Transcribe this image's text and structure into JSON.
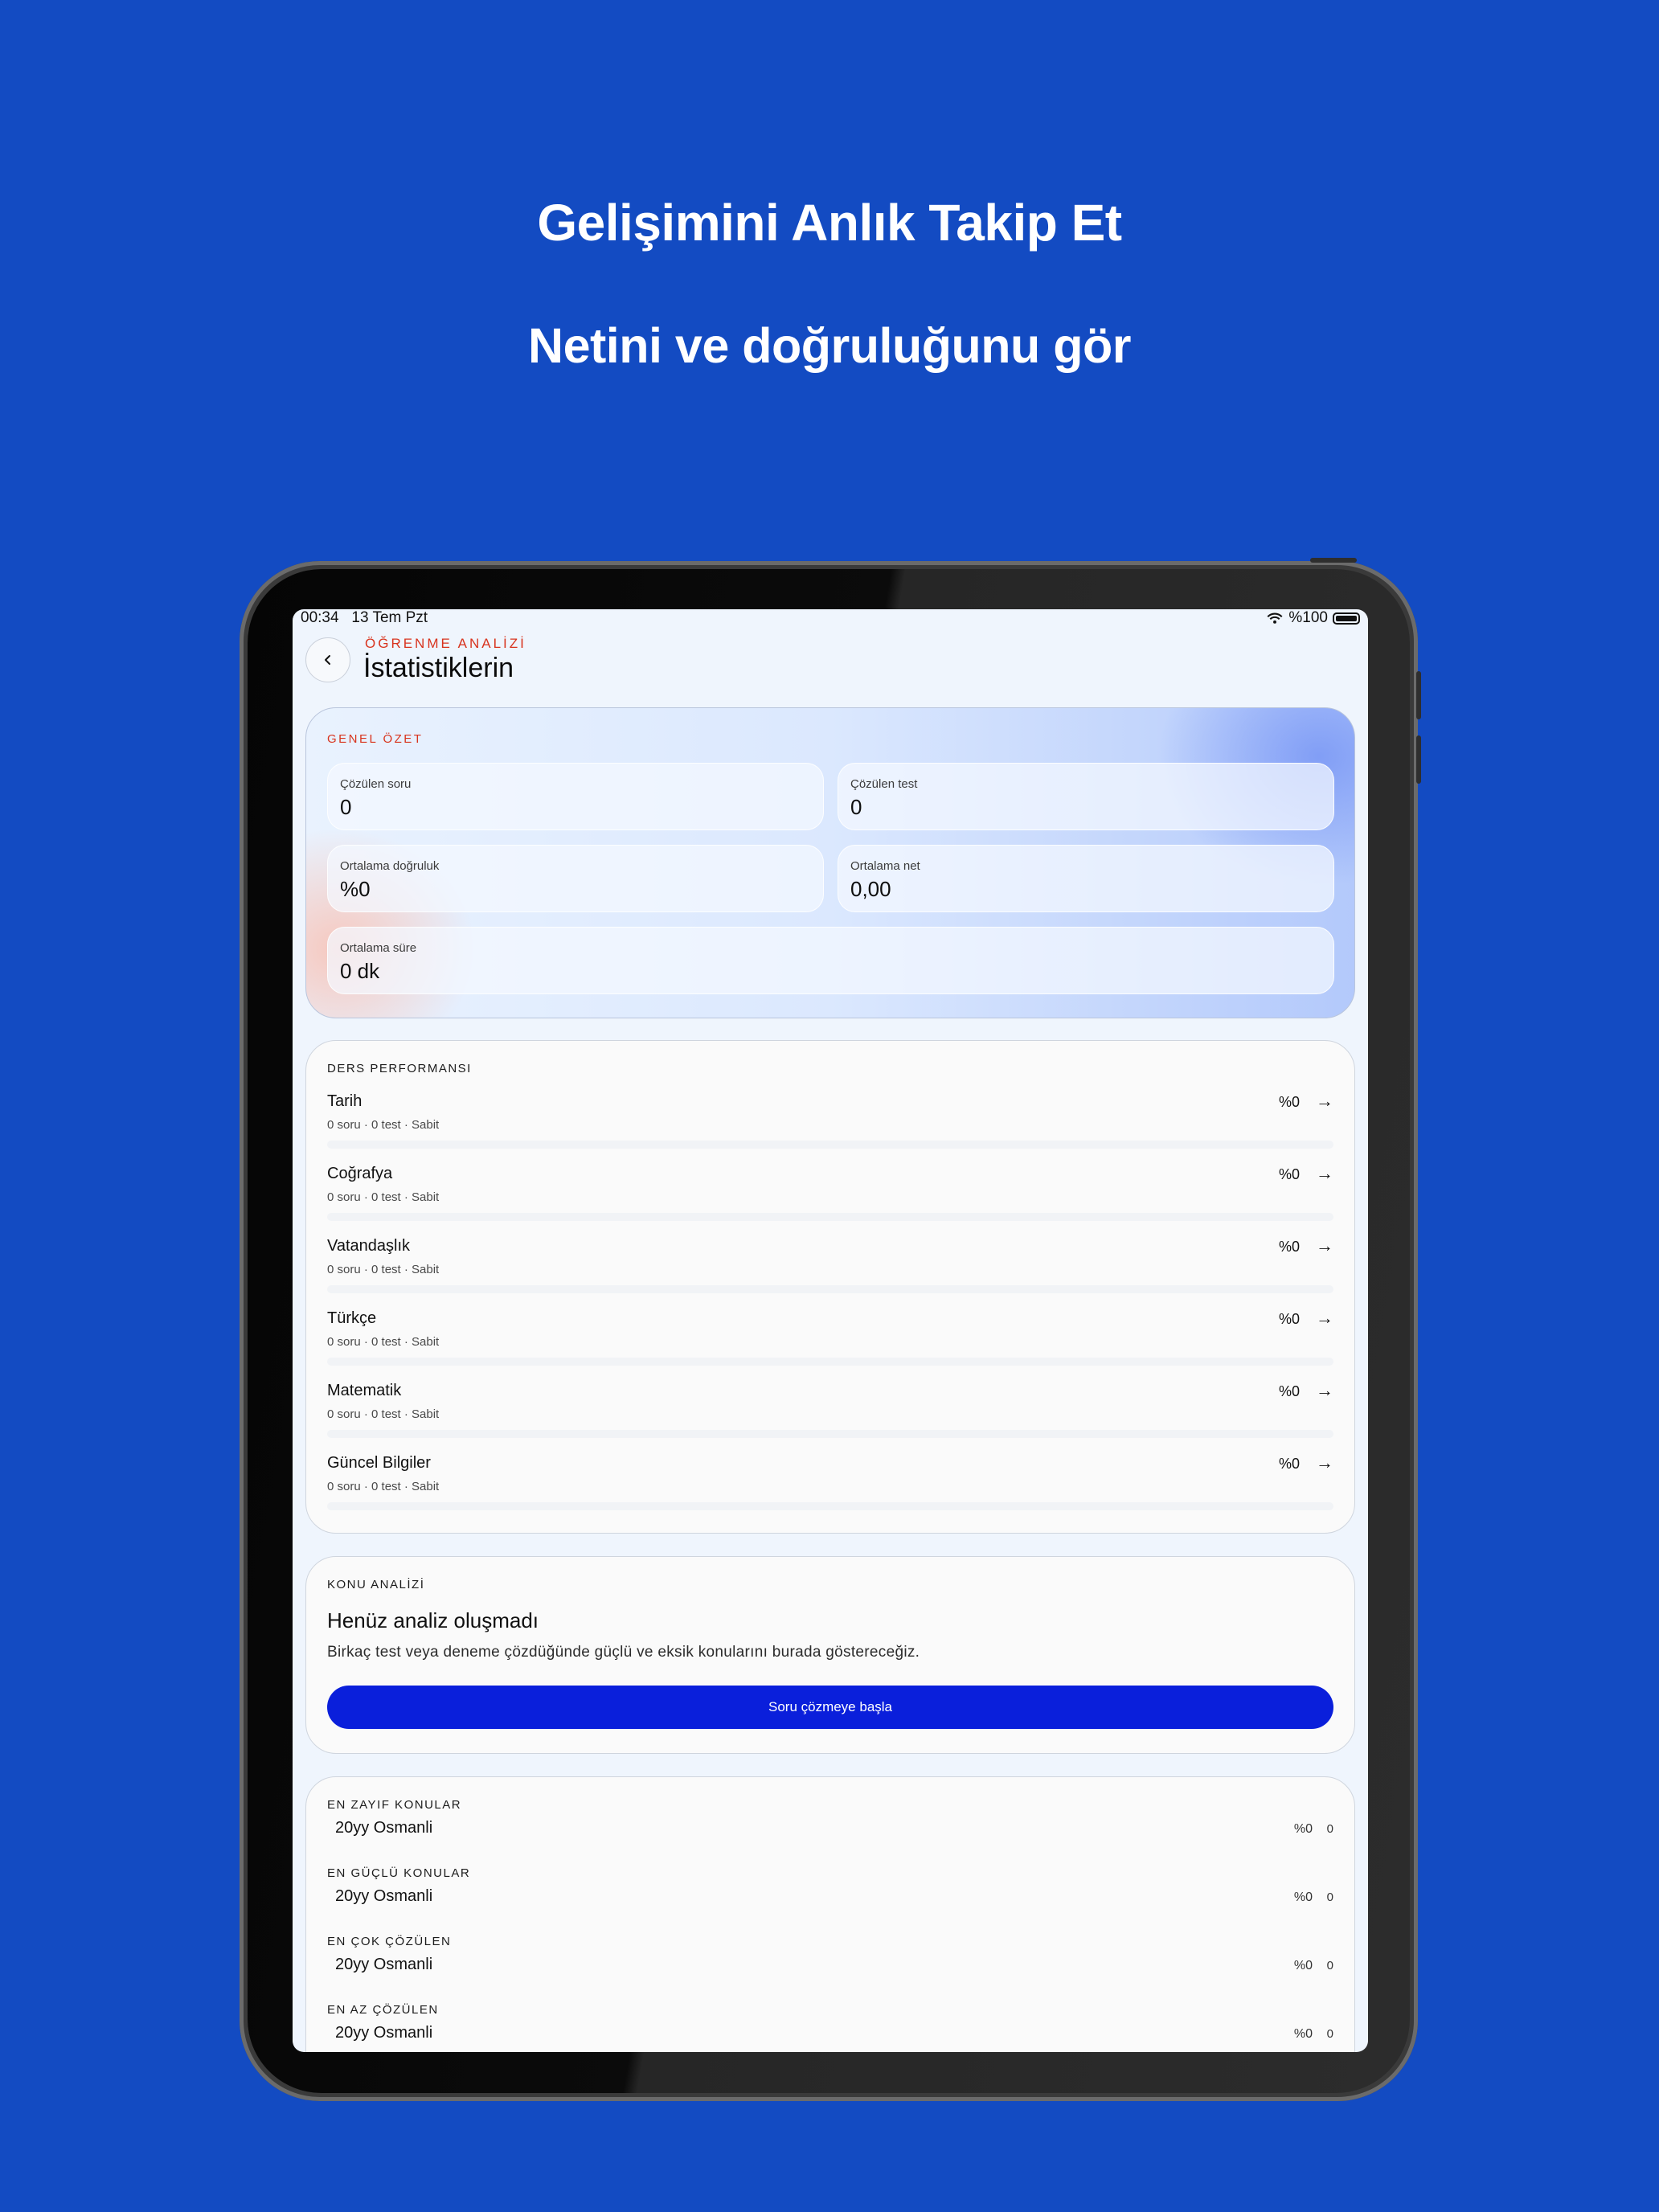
{
  "hero": {
    "title": "Gelişimini Anlık Takip Et",
    "subtitle": "Netini ve doğruluğunu gör"
  },
  "status_bar": {
    "time": "00:34",
    "date": "13 Tem Pzt",
    "battery": "%100"
  },
  "header": {
    "eyebrow": "ÖĞRENME ANALİZİ",
    "title": "İstatistiklerin"
  },
  "summary": {
    "label": "GENEL ÖZET",
    "solved_questions": {
      "label": "Çözülen soru",
      "value": "0"
    },
    "solved_tests": {
      "label": "Çözülen test",
      "value": "0"
    },
    "avg_accuracy": {
      "label": "Ortalama doğruluk",
      "value": "%0"
    },
    "avg_net": {
      "label": "Ortalama net",
      "value": "0,00"
    },
    "avg_time": {
      "label": "Ortalama süre",
      "value": "0 dk"
    }
  },
  "performance": {
    "label": "DERS PERFORMANSI",
    "subjects": [
      {
        "name": "Tarih",
        "meta": "0 soru · 0 test · Sabit",
        "percent": "%0",
        "progress": 0
      },
      {
        "name": "Coğrafya",
        "meta": "0 soru · 0 test · Sabit",
        "percent": "%0",
        "progress": 0
      },
      {
        "name": "Vatandaşlık",
        "meta": "0 soru · 0 test · Sabit",
        "percent": "%0",
        "progress": 0
      },
      {
        "name": "Türkçe",
        "meta": "0 soru · 0 test · Sabit",
        "percent": "%0",
        "progress": 0
      },
      {
        "name": "Matematik",
        "meta": "0 soru · 0 test · Sabit",
        "percent": "%0",
        "progress": 0
      },
      {
        "name": "Güncel Bilgiler",
        "meta": "0 soru · 0 test · Sabit",
        "percent": "%0",
        "progress": 0
      }
    ],
    "arrow": "→"
  },
  "topic_analysis": {
    "label": "KONU ANALİZİ",
    "empty_title": "Henüz analiz oluşmadı",
    "empty_description": "Birkaç test veya deneme çözdüğünde güçlü ve eksik konularını burada göstereceğiz.",
    "cta_label": "Soru çözmeye başla"
  },
  "rankings": [
    {
      "label": "EN ZAYIF KONULAR",
      "topic": "20yy Osmanli",
      "percent": "%0",
      "count": "0"
    },
    {
      "label": "EN GÜÇLÜ KONULAR",
      "topic": "20yy Osmanli",
      "percent": "%0",
      "count": "0"
    },
    {
      "label": "EN ÇOK ÇÖZÜLEN",
      "topic": "20yy Osmanli",
      "percent": "%0",
      "count": "0"
    },
    {
      "label": "EN AZ ÇÖZÜLEN",
      "topic": "20yy Osmanli",
      "percent": "%0",
      "count": "0"
    }
  ],
  "colors": {
    "background": "#134bc2",
    "accent_red": "#d8341e",
    "cta_blue": "#0a1fdb"
  }
}
